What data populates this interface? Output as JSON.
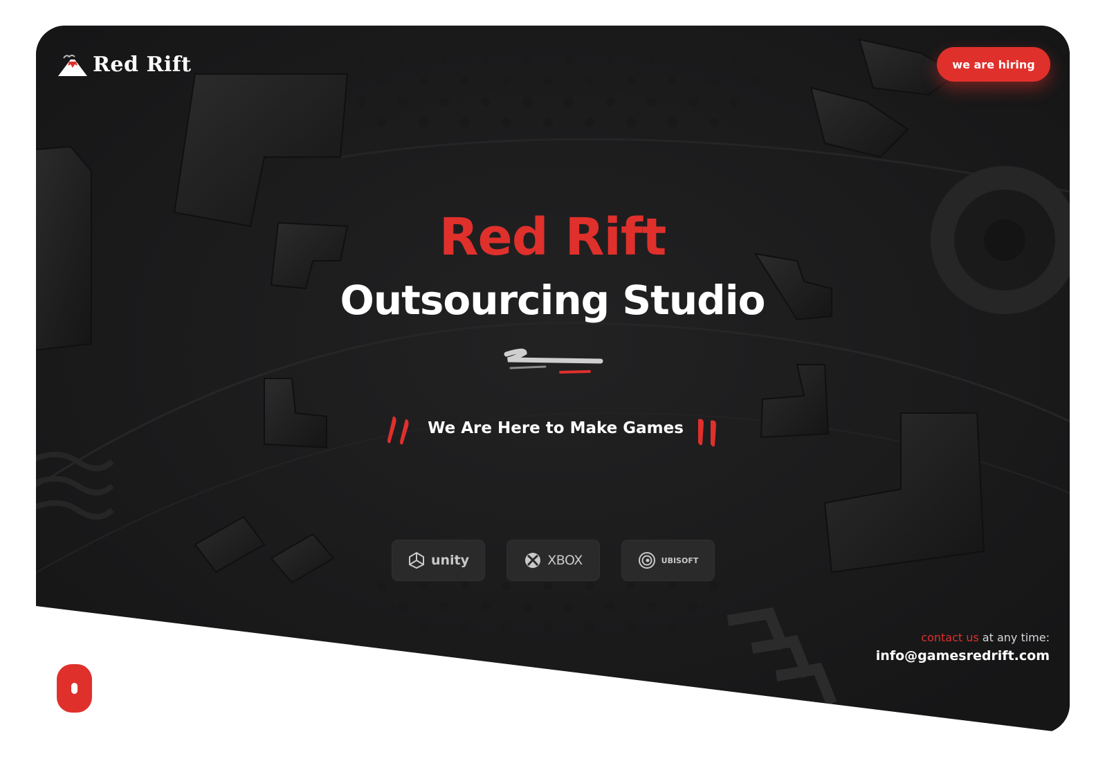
{
  "header": {
    "logo_text": "Red Rift",
    "logo_icon": "volcano-icon",
    "hire_label": "we are hiring"
  },
  "hero": {
    "title": "Red Rift",
    "subtitle": "Outsourcing Studio",
    "tagline": "We Are Here to Make Games"
  },
  "partners": [
    {
      "label": "unity",
      "icon": "unity-icon"
    },
    {
      "label": "XBOX",
      "icon": "xbox-icon"
    },
    {
      "label": "UBISOFT",
      "icon": "ubisoft-icon"
    }
  ],
  "contact": {
    "link_label": "contact us",
    "suffix": " at any time:",
    "email": "info@gamesredrift.com"
  },
  "colors": {
    "accent": "#e0302c",
    "background": "#1d1d1e",
    "tile": "#2a2a2b"
  },
  "scroll_icon": "mouse-scroll-icon"
}
